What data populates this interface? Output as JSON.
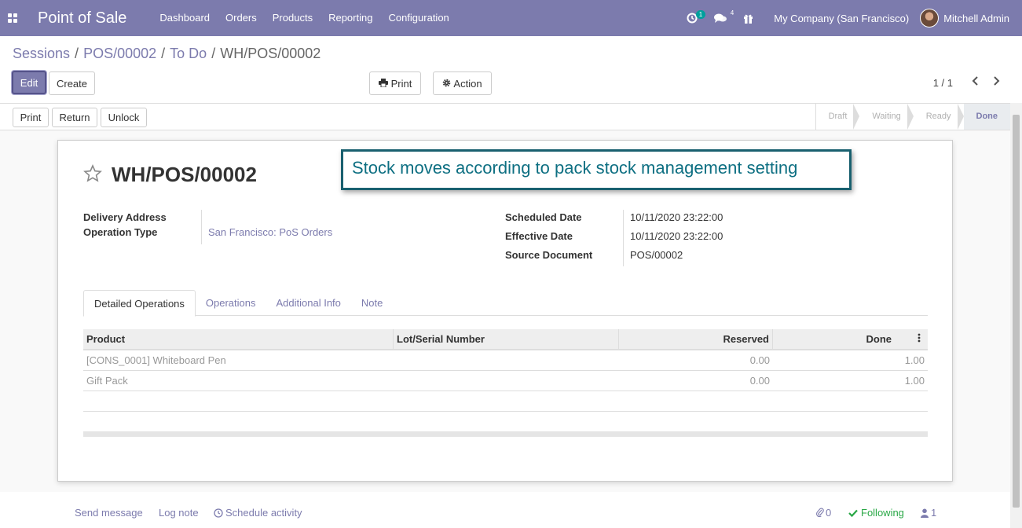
{
  "navbar": {
    "app_name": "Point of Sale",
    "menu": [
      "Dashboard",
      "Orders",
      "Products",
      "Reporting",
      "Configuration"
    ],
    "activity_count": "1",
    "message_count": "4",
    "company": "My Company (San Francisco)",
    "user": "Mitchell Admin"
  },
  "breadcrumb": [
    "Sessions",
    "POS/00002",
    "To Do",
    "WH/POS/00002"
  ],
  "buttons": {
    "edit": "Edit",
    "create": "Create",
    "print": "Print",
    "action": "Action"
  },
  "pager": "1 / 1",
  "status_buttons": [
    "Print",
    "Return",
    "Unlock"
  ],
  "stages": [
    "Draft",
    "Waiting",
    "Ready",
    "Done"
  ],
  "record": {
    "title": "WH/POS/00002",
    "callout": "Stock moves according to pack stock management setting",
    "fields_left": {
      "delivery_address_label": "Delivery Address",
      "operation_type_label": "Operation Type",
      "operation_type_value": "San Francisco: PoS Orders"
    },
    "fields_right": {
      "scheduled_date_label": "Scheduled Date",
      "scheduled_date_value": "10/11/2020 23:22:00",
      "effective_date_label": "Effective Date",
      "effective_date_value": "10/11/2020 23:22:00",
      "source_document_label": "Source Document",
      "source_document_value": "POS/00002"
    }
  },
  "tabs": [
    "Detailed Operations",
    "Operations",
    "Additional Info",
    "Note"
  ],
  "table": {
    "headers": [
      "Product",
      "Lot/Serial Number",
      "Reserved",
      "Done"
    ],
    "rows": [
      [
        "[CONS_0001] Whiteboard Pen",
        "",
        "0.00",
        "1.00"
      ],
      [
        "Gift Pack",
        "",
        "0.00",
        "1.00"
      ]
    ]
  },
  "chatter": {
    "send_message": "Send message",
    "log_note": "Log note",
    "schedule_activity": "Schedule activity",
    "attachments": "0",
    "following": "Following",
    "followers": "1"
  }
}
